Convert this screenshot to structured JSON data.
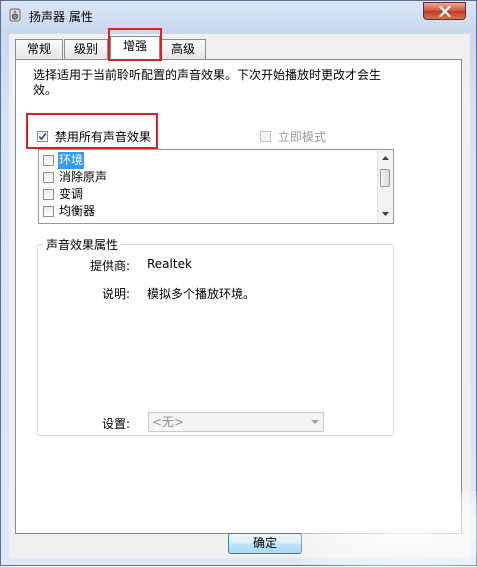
{
  "window": {
    "title": "扬声器 属性",
    "close_symbol": "×"
  },
  "tabs": [
    {
      "label": "常规",
      "active": false
    },
    {
      "label": "级别",
      "active": false
    },
    {
      "label": "增强",
      "active": true
    },
    {
      "label": "高级",
      "active": false
    }
  ],
  "enhancements": {
    "description": "选择适用于当前聆听配置的声音效果。下次开始播放时更改才会生效。",
    "disable_all": {
      "label": "禁用所有声音效果",
      "checked": true
    },
    "immediate_mode": {
      "label": "立即模式",
      "checked": false,
      "enabled": false
    },
    "effects": [
      {
        "label": "环境",
        "checked": false,
        "selected": true
      },
      {
        "label": "消除原声",
        "checked": false,
        "selected": false
      },
      {
        "label": "变调",
        "checked": false,
        "selected": false
      },
      {
        "label": "均衡器",
        "checked": false,
        "selected": false
      }
    ]
  },
  "properties": {
    "group_title": "声音效果属性",
    "provider_label": "提供商:",
    "provider_value": "Realtek",
    "description_label": "说明:",
    "description_value": "模拟多个播放环境。",
    "settings_label": "设置:",
    "settings_value": "<无>"
  },
  "buttons": {
    "ok": "确定"
  },
  "colors": {
    "highlight_box": "#e02020",
    "selection": "#3399ff"
  }
}
